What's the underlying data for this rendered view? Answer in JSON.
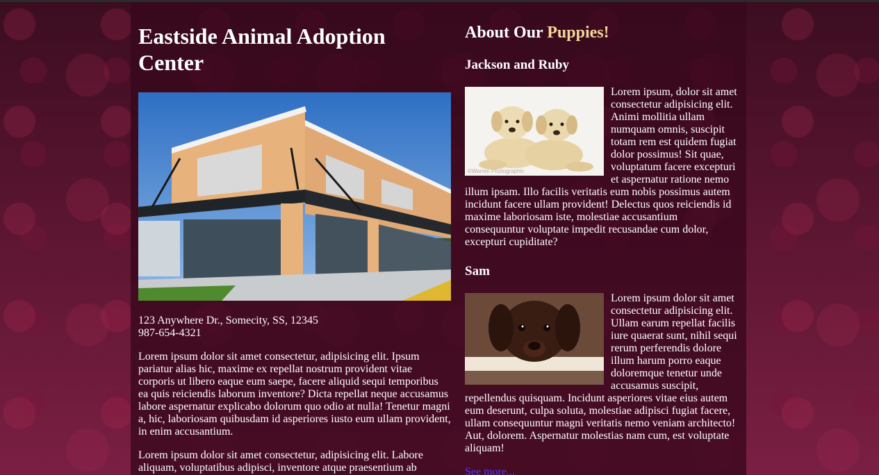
{
  "header": {
    "title": "Eastside Animal Adoption Center"
  },
  "center": {
    "address": "123 Anywhere Dr., Somecity, SS, 12345",
    "phone": "987-654-4321",
    "paragraphs": [
      "Lorem ipsum dolor sit amet consectetur, adipisicing elit. Ipsum pariatur alias hic, maxime ex repellat nostrum provident vitae corporis ut libero eaque eum saepe, facere aliquid sequi temporibus ea quis reiciendis laborum inventore? Dicta repellat neque accusamus labore aspernatur explicabo dolorum quo odio at nulla! Tenetur magni a, hic, laboriosam quibusdam id asperiores iusto eum ullam provident, in enim accusantium.",
      "Lorem ipsum dolor sit amet consectetur, adipisicing elit. Labore aliquam, voluptatibus adipisci, inventore atque praesentium ab dolores repellendus quasi laudantium sequi modi at tenetur."
    ]
  },
  "about": {
    "heading_prefix": "About Our ",
    "heading_accent": "Puppies!",
    "accent_color": "#f3d89a",
    "puppies": [
      {
        "name": "Jackson and Ruby",
        "image_watermark": "©Warren Photographic",
        "text": "Lorem ipsum, dolor sit amet consectetur adipisicing elit. Animi mollitia ullam numquam omnis, suscipit totam rem est quidem fugiat dolor possimus! Sit quae, voluptatum facere excepturi et aspernatur ratione nemo illum ipsam. Illo facilis veritatis eum nobis possimus autem incidunt facere ullam provident! Delectus quos reiciendis id maxime laboriosam iste, molestiae accusantium consequuntur voluptate impedit recusandae cum dolor, excepturi cupiditate?"
      },
      {
        "name": "Sam",
        "text": "Lorem ipsum dolor sit amet consectetur adipisicing elit. Ullam earum repellat facilis iure quaerat sunt, nihil sequi rerum perferendis dolore illum harum porro eaque doloremque tenetur unde accusamus suscipit, repellendus quisquam. Incidunt asperiores vitae eius autem eum deserunt, culpa soluta, molestiae adipisci fugiat facere, ullam consequuntur magni veritatis nemo veniam architecto! Aut, dolorem. Aspernatur molestias nam cum, est voluptate aliquam!"
      }
    ],
    "see_more_label": "See more...",
    "link_color": "#5b33ff"
  }
}
